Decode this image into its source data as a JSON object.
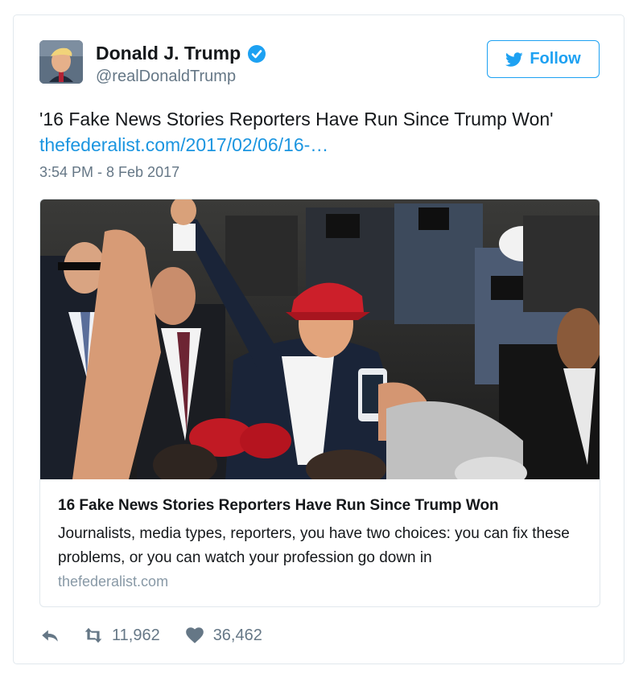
{
  "user": {
    "name": "Donald J. Trump",
    "handle": "@realDonaldTrump",
    "verified": true
  },
  "follow_label": "Follow",
  "tweet": {
    "text": "'16 Fake News Stories Reporters Have Run Since Trump Won'",
    "link": "thefederalist.com/2017/02/06/16-…",
    "timestamp": "3:54 PM - 8 Feb 2017"
  },
  "card": {
    "title": "16 Fake News Stories Reporters Have Run Since Trump Won",
    "description": "Journalists, media types, reporters, you have two choices: you can fix these problems, or you can watch your profession go down in",
    "domain": "thefederalist.com"
  },
  "actions": {
    "retweets": "11,962",
    "likes": "36,462"
  },
  "colors": {
    "accent": "#1da1f2",
    "link": "#1b95e0",
    "secondary_text": "#657786",
    "border": "#e1e8ed"
  },
  "icons": [
    "verified-badge-icon",
    "twitter-bird-icon",
    "reply-icon",
    "retweet-icon",
    "heart-icon"
  ]
}
